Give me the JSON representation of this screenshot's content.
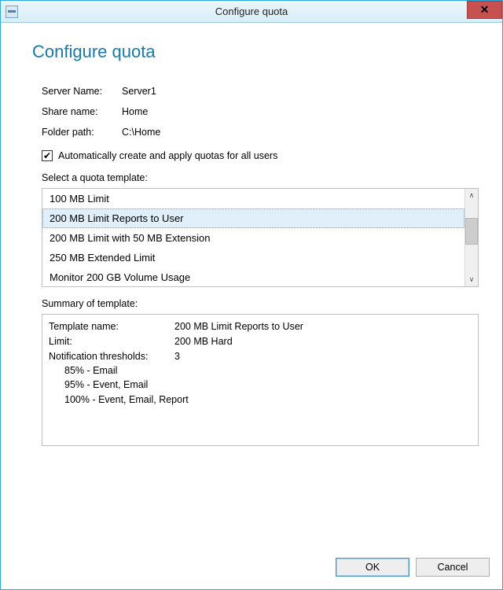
{
  "window": {
    "title": "Configure quota"
  },
  "page": {
    "title": "Configure quota"
  },
  "info": {
    "server_label": "Server Name:",
    "server_value": "Server1",
    "share_label": "Share name:",
    "share_value": "Home",
    "folder_label": "Folder path:",
    "folder_value": "C:\\Home"
  },
  "checkbox": {
    "label": "Automatically create and apply quotas for all users",
    "checked_glyph": "✔"
  },
  "templates": {
    "label": "Select a quota template:",
    "items": [
      "100 MB Limit",
      "200 MB Limit Reports to User",
      "200 MB Limit with 50 MB Extension",
      "250 MB Extended Limit",
      "Monitor 200 GB Volume Usage"
    ],
    "selected_index": 1
  },
  "summary": {
    "label": "Summary of template:",
    "template_name_label": "Template name:",
    "template_name_value": "200 MB Limit Reports to User",
    "limit_label": "Limit:",
    "limit_value": "200 MB Hard",
    "thresholds_label": "Notification thresholds:",
    "thresholds_count": "3",
    "thresholds": [
      "85% - Email",
      "95% - Event, Email",
      "100% - Event, Email, Report"
    ]
  },
  "buttons": {
    "ok": "OK",
    "cancel": "Cancel"
  }
}
